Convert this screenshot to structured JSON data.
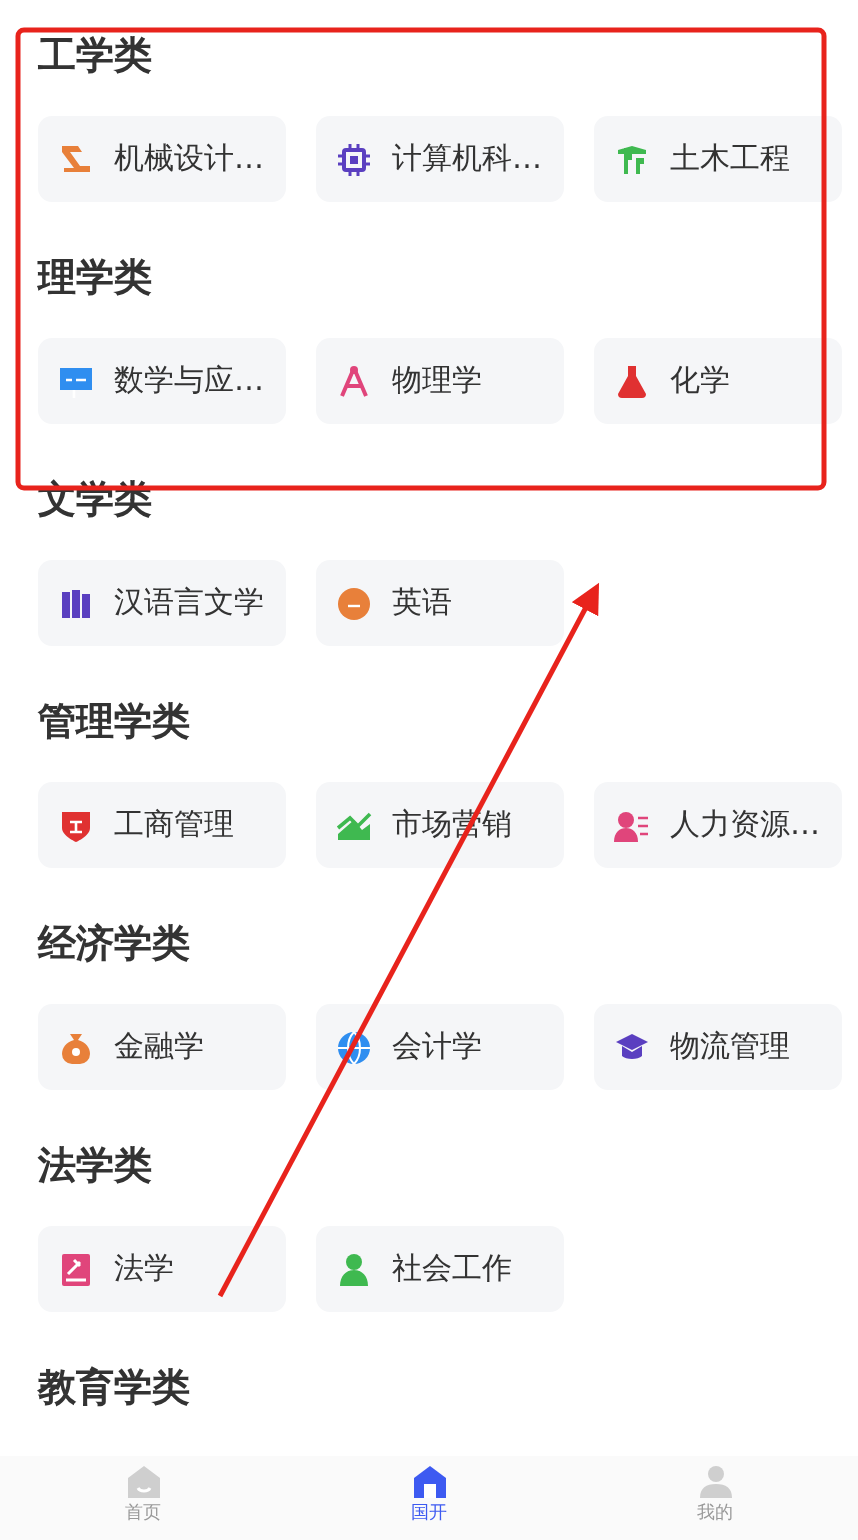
{
  "categories": [
    {
      "title": "工学类",
      "majors": [
        "机械设计…",
        "计算机科…",
        "土木工程"
      ]
    },
    {
      "title": "理学类",
      "majors": [
        "数学与应…",
        "物理学",
        "化学"
      ]
    },
    {
      "title": "文学类",
      "majors": [
        "汉语言文学",
        "英语"
      ]
    },
    {
      "title": "管理学类",
      "majors": [
        "工商管理",
        "市场营销",
        "人力资源…"
      ]
    },
    {
      "title": "经济学类",
      "majors": [
        "金融学",
        "会计学",
        "物流管理"
      ]
    },
    {
      "title": "法学类",
      "majors": [
        "法学",
        "社会工作"
      ]
    },
    {
      "title": "教育学类"
    }
  ],
  "tab_bar": [
    {
      "label": "首页",
      "selected": false
    },
    {
      "label": "国开",
      "selected": true
    },
    {
      "label": "我的",
      "selected": false
    }
  ]
}
